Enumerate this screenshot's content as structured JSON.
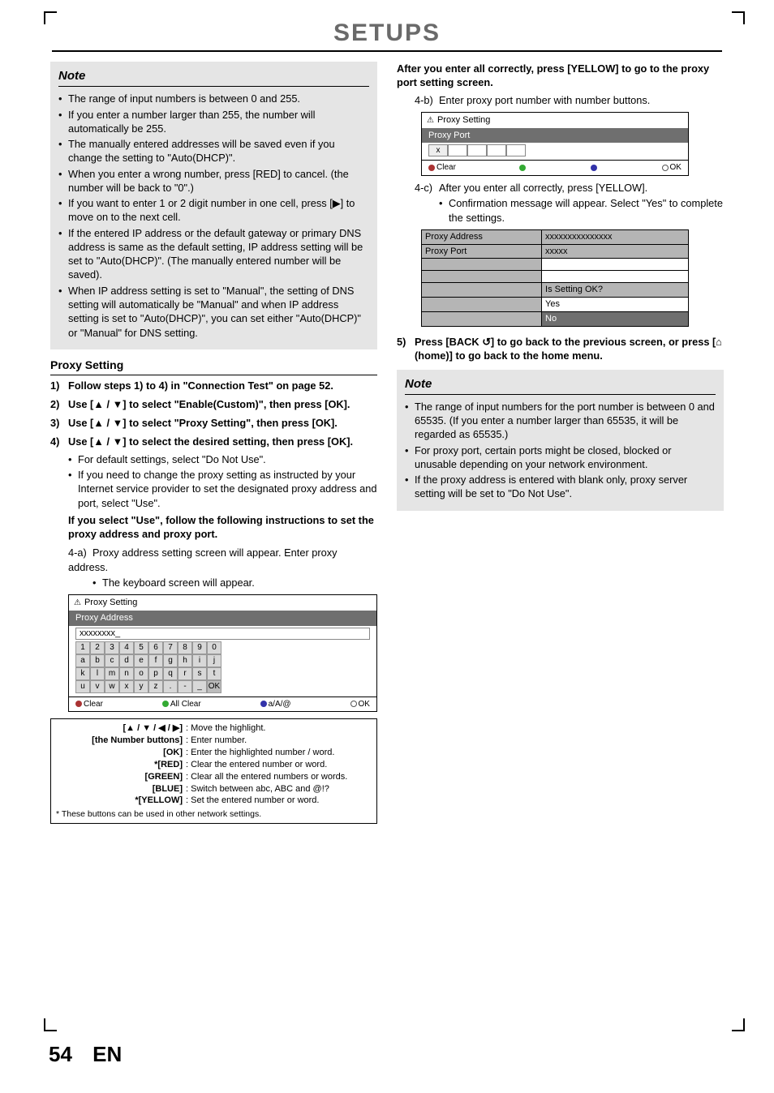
{
  "header": {
    "title": "SETUPS"
  },
  "left": {
    "note_title": "Note",
    "notes": [
      "The range of input numbers is between 0 and 255.",
      "If you enter a number larger than 255, the number will automatically be 255.",
      "The manually entered addresses will be saved even if you change the setting to \"Auto(DHCP)\".",
      "When you enter a wrong number, press [RED] to cancel. (the number will be back to \"0\".)",
      "If you want to enter 1 or 2 digit number in one cell, press [▶] to move on to the next cell.",
      "If the entered IP address or the default gateway or primary DNS address is same as the default setting, IP address setting will be set to \"Auto(DHCP)\". (The manually entered number will be saved).",
      "When IP address setting is set to \"Manual\", the setting of DNS setting will automatically be \"Manual\" and when IP address setting is set to \"Auto(DHCP)\", you can set either \"Auto(DHCP)\" or \"Manual\" for DNS setting."
    ],
    "proxy_heading": "Proxy Setting",
    "steps": {
      "s1": "Follow steps 1) to 4) in \"Connection Test\" on page 52.",
      "s2": "Use [▲ / ▼] to select \"Enable(Custom)\", then press [OK].",
      "s3": "Use [▲ / ▼] to select \"Proxy Setting\", then press [OK].",
      "s4": "Use [▲ / ▼] to select the desired setting, then press [OK].",
      "s4_b1": "For default settings, select \"Do Not Use\".",
      "s4_b2": "If you need to change the proxy setting as instructed by your Internet service provider to set the designated proxy address and port, select \"Use\".",
      "sub_instr": "If you select \"Use\", follow the following instructions to set the proxy address and proxy port.",
      "s4a_1": "Proxy address setting screen will appear. Enter proxy address.",
      "s4a_2": "The keyboard screen will appear."
    },
    "screen1": {
      "head": "Proxy Setting",
      "bar": "Proxy Address",
      "input": "xxxxxxxx_",
      "keys_row1": [
        "1",
        "2",
        "3",
        "4",
        "5",
        "6",
        "7",
        "8",
        "9",
        "0"
      ],
      "keys_row2": [
        "a",
        "b",
        "c",
        "d",
        "e",
        "f",
        "g",
        "h",
        "i",
        "j"
      ],
      "keys_row3": [
        "k",
        "l",
        "m",
        "n",
        "o",
        "p",
        "q",
        "r",
        "s",
        "t"
      ],
      "keys_row4": [
        "u",
        "v",
        "w",
        "x",
        "y",
        "z",
        ".",
        "-",
        "_",
        "OK"
      ],
      "foot_clear": "Clear",
      "foot_allclear": "All Clear",
      "foot_mode": "a/A/@",
      "foot_ok": "OK"
    },
    "legend": {
      "r1k": "[▲ / ▼ / ◀ / ▶]",
      "r1d": ": Move the highlight.",
      "r2k": "[the Number buttons]",
      "r2d": ": Enter number.",
      "r3k": "[OK]",
      "r3d": ": Enter the highlighted number / word.",
      "r4k": "*[RED]",
      "r4d": ": Clear the entered number or word.",
      "r5k": "[GREEN]",
      "r5d": ": Clear all the entered numbers or words.",
      "r6k": "[BLUE]",
      "r6d": ": Switch between abc, ABC and @!?",
      "r7k": "*[YELLOW]",
      "r7d": ": Set the entered number or word.",
      "note": "* These buttons can be used in other network settings."
    }
  },
  "right": {
    "top_bold": "After you enter all correctly, press [YELLOW] to go to the proxy port setting screen.",
    "s4b": "Enter proxy port number with number buttons.",
    "screen2": {
      "head": "Proxy Setting",
      "bar": "Proxy Port",
      "val": "x",
      "foot_clear": "Clear",
      "foot_ok": "OK"
    },
    "s4c": "After you enter all correctly, press [YELLOW].",
    "s4c_sub": "Confirmation message will appear. Select \"Yes\" to complete the settings.",
    "confirm": {
      "r1a": "Proxy Address",
      "r1b": "xxxxxxxxxxxxxxx",
      "r2a": "Proxy Port",
      "r2b": "xxxxx",
      "msg": "Is Setting OK?",
      "yes": "Yes",
      "no": "No"
    },
    "s5": "Press [BACK ↺] to go back to the previous screen, or press [⌂ (home)] to go back to the home menu.",
    "note_title": "Note",
    "notes": [
      "The range of input numbers for the port number is between 0 and 65535.  (If you enter a number larger than 65535, it will be regarded as 65535.)",
      "For proxy port, certain ports might be closed, blocked or unusable depending on  your network environment.",
      "If the proxy address is entered with blank only, proxy server setting will be set to \"Do Not Use\"."
    ]
  },
  "footer": {
    "page": "54",
    "lang": "EN"
  }
}
